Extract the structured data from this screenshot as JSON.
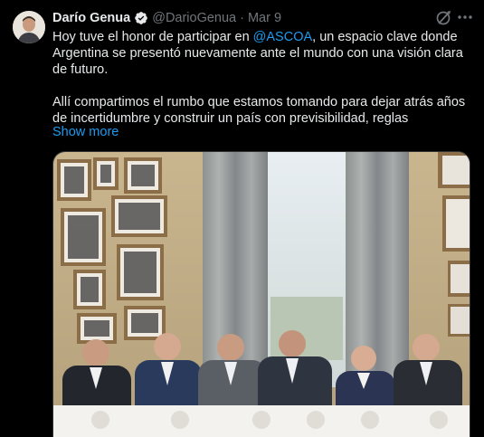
{
  "author": {
    "name": "Darío Genua",
    "handle": "@DarioGenua",
    "separator": "·",
    "date": "Mar 9"
  },
  "tweet": {
    "line1_pre": "Hoy tuve el honor de participar en ",
    "mention": "@ASCOA",
    "line1_post": ", un espacio clave donde Argentina se presentó nuevamente ante el mundo con una visión clara de futuro.",
    "paragraph2": "Allí compartimos el rumbo que estamos tomando para dejar atrás años de incertidumbre y construir un país con previsibilidad, reglas",
    "show_more": "Show more"
  },
  "icons": {
    "verified": "verified-badge-icon",
    "grok": "grok-icon",
    "more": "more-options-icon"
  },
  "colors": {
    "background": "#000000",
    "text": "#e7e9ea",
    "secondary": "#71767b",
    "accent": "#1d9bf0"
  }
}
